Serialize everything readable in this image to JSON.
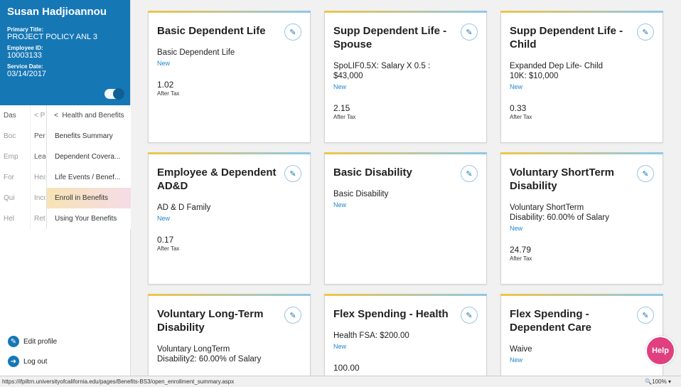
{
  "profile": {
    "name": "Susan Hadjioannou",
    "title_label": "Primary Title:",
    "title_value": "PROJECT POLICY ANL 3",
    "id_label": "Employee ID:",
    "id_value": "10003133",
    "date_label": "Service Date:",
    "date_value": "03/14/2017"
  },
  "nav": {
    "col1": [
      "Das",
      "Boc",
      "Emp",
      "For",
      "Qui",
      "Hel"
    ],
    "col2": [
      "<  P",
      "Pers",
      "Lea",
      "Hea",
      "Inco",
      "Ret"
    ],
    "header": "Health and Benefits",
    "items": [
      "Benefits Summary",
      "Dependent Covera...",
      "Life Events / Benef...",
      "Enroll in Benefits",
      "Using Your Benefits"
    ]
  },
  "footer": {
    "edit_profile": "Edit profile",
    "log_out": "Log out"
  },
  "cards": [
    {
      "title": "Basic Dependent Life",
      "plan": "Basic Dependent Life",
      "badge": "New",
      "cost": "1.02",
      "cost_label": "After Tax"
    },
    {
      "title": "Supp Dependent Life - Spouse",
      "plan": "SpoLIF0.5X: Salary X 0.5 : $43,000",
      "badge": "New",
      "cost": "2.15",
      "cost_label": "After Tax"
    },
    {
      "title": "Supp Dependent Life - Child",
      "plan": "Expanded Dep Life- Child 10K: $10,000",
      "badge": "New",
      "cost": "0.33",
      "cost_label": "After Tax"
    },
    {
      "title": "Employee & Dependent AD&D",
      "plan": "AD & D Family",
      "badge": "New",
      "cost": "0.17",
      "cost_label": "After Tax"
    },
    {
      "title": "Basic Disability",
      "plan": "Basic Disability",
      "badge": "New",
      "cost": "",
      "cost_label": ""
    },
    {
      "title": "Voluntary ShortTerm Disability",
      "plan": "Voluntary ShortTerm Disability: 60.00% of Salary",
      "badge": "New",
      "cost": "24.79",
      "cost_label": "After Tax"
    },
    {
      "title": "Voluntary Long-Term Disability",
      "plan": "Voluntary LongTerm Disability2: 60.00% of Salary",
      "badge": "",
      "cost": "",
      "cost_label": ""
    },
    {
      "title": "Flex Spending - Health",
      "plan": "Health FSA: $200.00",
      "badge": "New",
      "cost": "100.00",
      "cost_label": ""
    },
    {
      "title": "Flex Spending - Dependent Care",
      "plan": "Waive",
      "badge": "New",
      "cost": "",
      "cost_label": ""
    }
  ],
  "help_label": "Help",
  "status": {
    "url": "https://ifpiltrn.universityofcalifornia.edu/pages/Benefits-BS3/open_enrollment_summary.aspx",
    "zoom": "100%"
  },
  "icons": {
    "edit": "pencil-icon",
    "edit_profile": "pencil-icon",
    "log_out": "logout-arrow-icon"
  },
  "colors": {
    "accent": "#1677b5",
    "help": "#e0407f",
    "new_badge": "#2187d0"
  }
}
